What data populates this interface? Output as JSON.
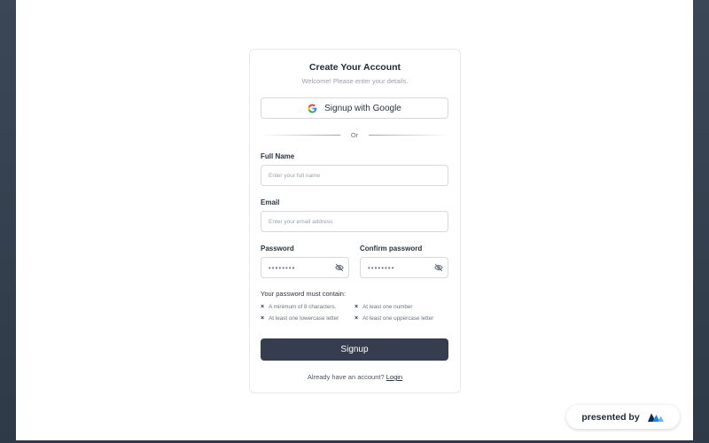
{
  "form": {
    "title": "Create Your Account",
    "subtitle": "Welcome! Please enter your details.",
    "google_button_label": "Signup with Google",
    "divider_text": "Or",
    "full_name": {
      "label": "Full Name",
      "placeholder": "Enter your full name"
    },
    "email": {
      "label": "Email",
      "placeholder": "Enter your email address"
    },
    "password": {
      "label": "Password",
      "value": "••••••••"
    },
    "confirm_password": {
      "label": "Confirm password",
      "value": "••••••••"
    },
    "requirements": {
      "title": "Your password must contain:",
      "items": [
        "A minimum of 8 characters.",
        "At least one number",
        "At least one lowercase letter",
        "At least one uppercase letter"
      ]
    },
    "signup_button_label": "Signup",
    "login_prompt": "Already have an account?",
    "login_link": "Login"
  },
  "badge": {
    "text": "presented by",
    "logo_icon": "brand-logo-icon"
  },
  "colors": {
    "primary_button": "#363d4e",
    "background": "#3b4757",
    "brand_blue": "#1e88e5"
  }
}
